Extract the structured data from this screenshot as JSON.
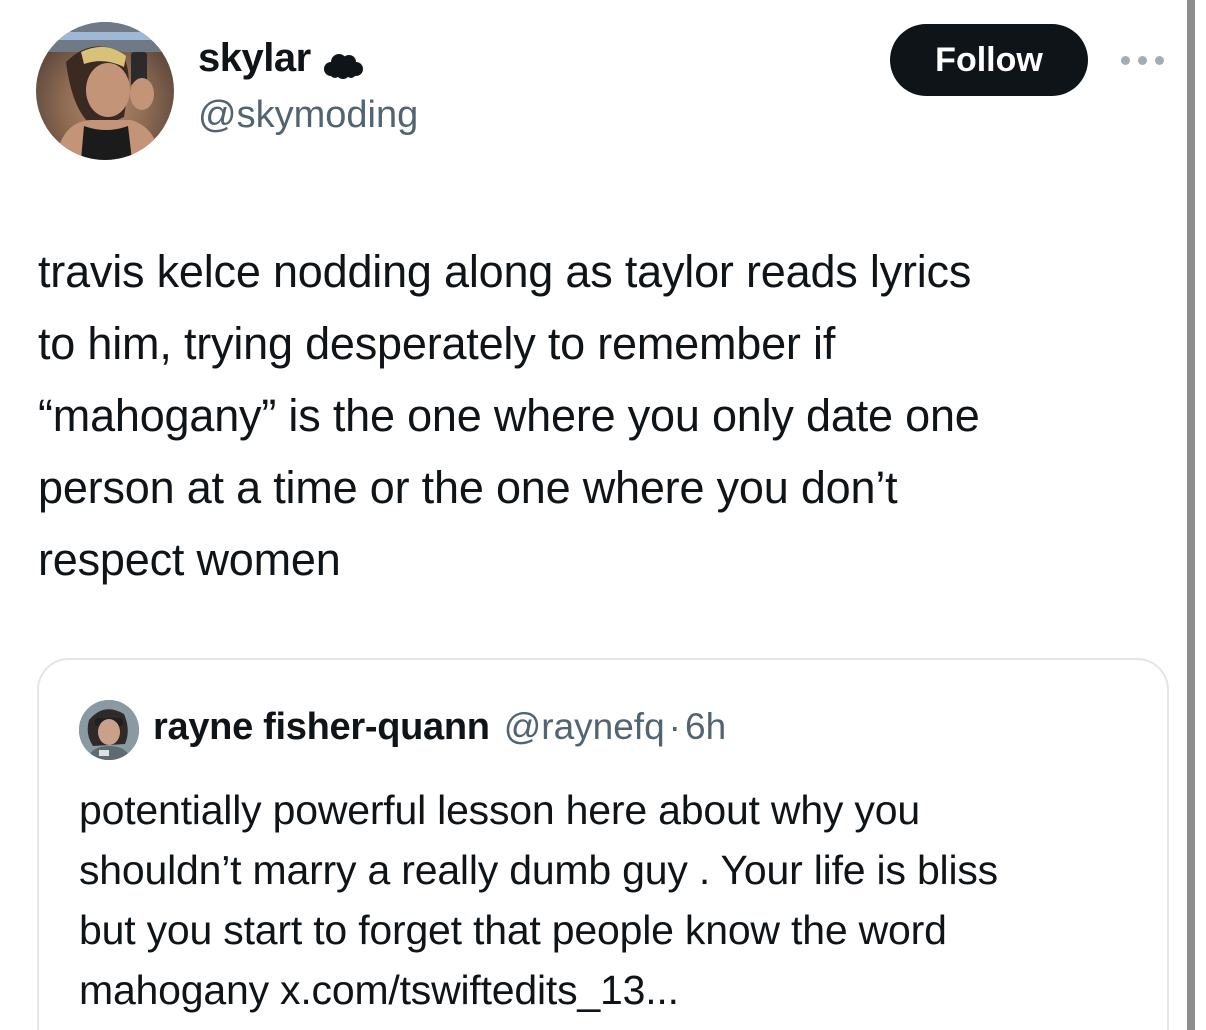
{
  "author": {
    "display_name": "skylar",
    "badge_icon": "cloud-icon",
    "handle": "@skymoding",
    "avatar_icon": "profile-photo"
  },
  "actions": {
    "follow_label": "Follow",
    "more_icon": "more-options-icon"
  },
  "tweet": {
    "text": "travis kelce nodding along as taylor reads lyrics\nto him, trying desperately to remember if\n“mahogany” is the one where you only date one\nperson at a time or the one where you don’t\nrespect women"
  },
  "quote": {
    "display_name": "rayne fisher-quann",
    "handle": "@raynefq",
    "separator": "·",
    "time": "6h",
    "text": "potentially powerful lesson here about why you\nshouldn’t marry a really dumb guy . Your life is bliss\nbut you start to forget that people know the word\nmahogany x.com/tswiftedits_13..."
  },
  "colors": {
    "text_primary": "#0f1419",
    "text_secondary": "#536471",
    "follow_bg": "#0f1419",
    "border": "#e1e6ea"
  }
}
